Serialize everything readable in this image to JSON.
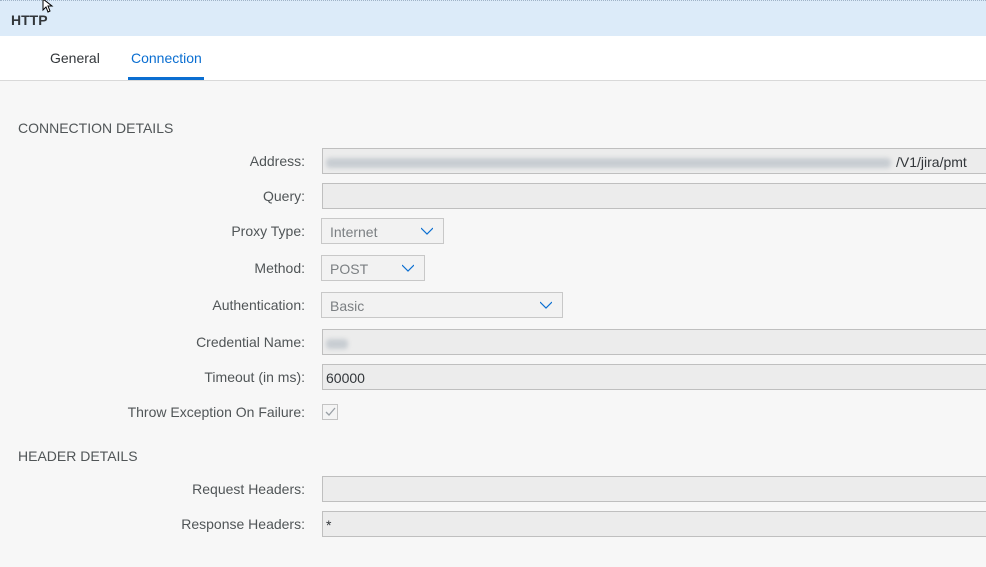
{
  "header": {
    "title": "HTTP"
  },
  "tabs": [
    {
      "label": "General"
    },
    {
      "label": "Connection"
    }
  ],
  "sections": {
    "connection": "CONNECTION DETAILS",
    "header": "HEADER DETAILS"
  },
  "form": {
    "address": {
      "label": "Address:",
      "value_tail": "/V1/jira/pmt"
    },
    "query": {
      "label": "Query:",
      "value": ""
    },
    "proxy_type": {
      "label": "Proxy Type:",
      "value": "Internet"
    },
    "method": {
      "label": "Method:",
      "value": "POST"
    },
    "authentication": {
      "label": "Authentication:",
      "value": "Basic"
    },
    "credential_name": {
      "label": "Credential Name:"
    },
    "timeout": {
      "label": "Timeout (in ms):",
      "value": "60000"
    },
    "throw_exception": {
      "label": "Throw Exception On Failure:",
      "checked": true
    },
    "request_headers": {
      "label": "Request Headers:",
      "value": ""
    },
    "response_headers": {
      "label": "Response Headers:",
      "value": "*"
    }
  },
  "colors": {
    "accent": "#0a6ed1",
    "header_bg": "#dcebf9",
    "page_bg": "#f7f7f7"
  }
}
